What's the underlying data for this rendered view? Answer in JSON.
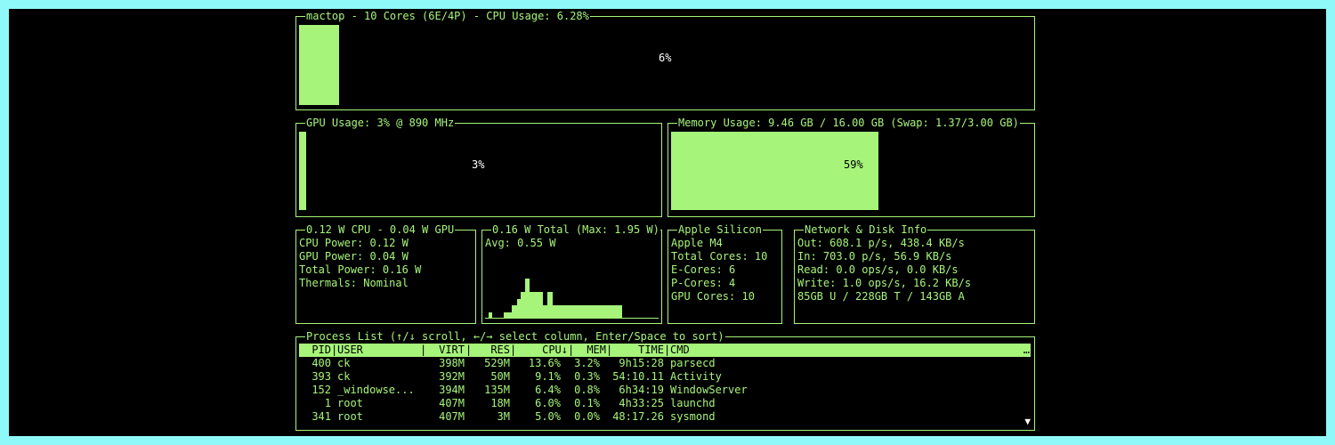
{
  "cpu": {
    "title": "mactop - 10 Cores (6E/4P) - CPU Usage: 6.28%",
    "percent_label": "6%",
    "percent": 6
  },
  "gpu": {
    "title": "GPU Usage: 3% @ 890 MHz",
    "percent_label": "3%",
    "percent": 3
  },
  "memory": {
    "title": "Memory Usage: 9.46 GB / 16.00 GB (Swap: 1.37/3.00 GB)",
    "percent_label": "59%",
    "percent": 59
  },
  "power": {
    "title": "0.12 W CPU - 0.04 W GPU",
    "lines": [
      "CPU Power: 0.12 W",
      "GPU Power: 0.04 W",
      "Total Power: 0.16 W",
      "Thermals: Nominal"
    ]
  },
  "total_power": {
    "title": "0.16 W Total (Max: 1.95 W)",
    "avg": "Avg: 0.55 W",
    "history": [
      0,
      0,
      0.5,
      0.5,
      0,
      0,
      0,
      0,
      0,
      0,
      0,
      0.5,
      0.5,
      0.5,
      0.5,
      0.5,
      1,
      1,
      1,
      1.5,
      1.5,
      2,
      2,
      2,
      3,
      3,
      2,
      2,
      2,
      2,
      2,
      2,
      2,
      2,
      1,
      1,
      1,
      2,
      2,
      2,
      1,
      1,
      1,
      1,
      1,
      1,
      1,
      1,
      1,
      1,
      1,
      1,
      1,
      1,
      1,
      1,
      1,
      1,
      1,
      1,
      1,
      1,
      1,
      1,
      1,
      1,
      1,
      1,
      1,
      1,
      1,
      1,
      1,
      1,
      1,
      1,
      1,
      1,
      1,
      1,
      1,
      0,
      0,
      0,
      0,
      0,
      0,
      0,
      0,
      0,
      0,
      0,
      0,
      0,
      0,
      0,
      0,
      0,
      0,
      0,
      0,
      0,
      0
    ]
  },
  "apple_silicon": {
    "title": "Apple Silicon",
    "lines": [
      "Apple M4",
      "Total Cores: 10",
      "E-Cores: 6",
      "P-Cores: 4",
      "GPU Cores: 10"
    ]
  },
  "network": {
    "title": "Network & Disk Info",
    "lines": [
      "Out: 608.1 p/s, 438.4 KB/s",
      "In: 703.0 p/s, 56.9 KB/s",
      "Read: 0.0 ops/s, 0.0 KB/s",
      "Write: 1.0 ops/s, 16.2 KB/s",
      "85GB U / 228GB T / 143GB A"
    ]
  },
  "process": {
    "title": "Process List (↑/↓ scroll, ←/→ select column, Enter/Space to sort)",
    "headers": {
      "pid": "PID",
      "user": "USER",
      "virt": "VIRT",
      "res": "RES",
      "cpu": "CPU↓",
      "mem": "MEM",
      "time": "TIME",
      "cmd": "CMD"
    },
    "overflow": "…",
    "rows": [
      {
        "pid": "400",
        "user": "ck",
        "virt": "398M",
        "res": "529M",
        "cpu": "13.6%",
        "mem": "3.2%",
        "time": "9h15:28",
        "cmd": "parsecd"
      },
      {
        "pid": "393",
        "user": "ck",
        "virt": "392M",
        "res": "50M",
        "cpu": "9.1%",
        "mem": "0.3%",
        "time": "54:10.11",
        "cmd": "Activity"
      },
      {
        "pid": "152",
        "user": "_windowse...",
        "virt": "394M",
        "res": "135M",
        "cpu": "6.4%",
        "mem": "0.8%",
        "time": "6h34:19",
        "cmd": "WindowServer"
      },
      {
        "pid": "1",
        "user": "root",
        "virt": "407M",
        "res": "18M",
        "cpu": "6.0%",
        "mem": "0.1%",
        "time": "4h33:25",
        "cmd": "launchd"
      },
      {
        "pid": "341",
        "user": "root",
        "virt": "407M",
        "res": "3M",
        "cpu": "5.0%",
        "mem": "0.0%",
        "time": "48:17.26",
        "cmd": "sysmond"
      }
    ],
    "scroll_indicator": "▼"
  },
  "colors": {
    "accent": "#a6f47a",
    "background": "#000000",
    "frame": "#8ff9f9"
  }
}
